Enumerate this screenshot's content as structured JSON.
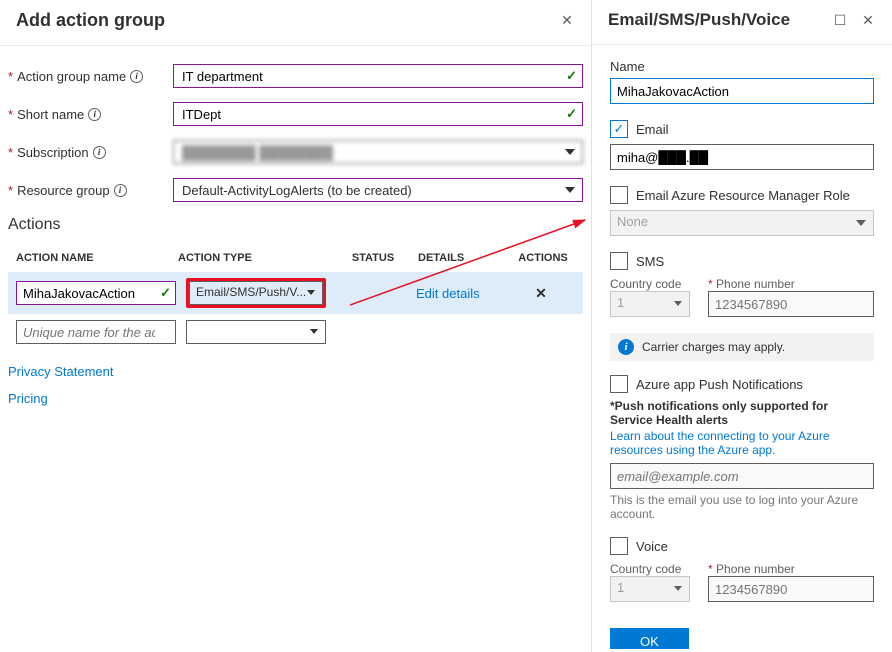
{
  "left_panel": {
    "title": "Add action group",
    "fields": {
      "action_group_name": {
        "label": "Action group name",
        "value": "IT department"
      },
      "short_name": {
        "label": "Short name",
        "value": "ITDept"
      },
      "subscription": {
        "label": "Subscription",
        "value": "████████  ████████"
      },
      "resource_group": {
        "label": "Resource group",
        "value": "Default-ActivityLogAlerts (to be created)"
      }
    },
    "actions_section": "Actions",
    "columns": {
      "name": "ACTION NAME",
      "type": "ACTION TYPE",
      "status": "STATUS",
      "details": "DETAILS",
      "actions": "ACTIONS"
    },
    "rows": [
      {
        "name": "MihaJakovacAction",
        "type": "Email/SMS/Push/V...",
        "details": "Edit details"
      }
    ],
    "placeholder_row": "Unique name for the act...",
    "links": {
      "privacy": "Privacy Statement",
      "pricing": "Pricing"
    }
  },
  "right_panel": {
    "title": "Email/SMS/Push/Voice",
    "name_label": "Name",
    "name_value": "MihaJakovacAction",
    "email_cb": "Email",
    "email_value": "miha@███.██",
    "arm_cb": "Email Azure Resource Manager Role",
    "arm_value": "None",
    "sms_cb": "SMS",
    "country_label": "Country code",
    "phone_label": "Phone number",
    "country_value": "1",
    "phone_ph": "1234567890",
    "info_bar": "Carrier charges may apply.",
    "push_cb": "Azure app Push Notifications",
    "push_note": "*Push notifications only supported for Service Health alerts",
    "push_learn": "Learn about the connecting to your Azure resources using the Azure app.",
    "push_ph": "email@example.com",
    "push_helper": "This is the email you use to log into your Azure account.",
    "voice_cb": "Voice",
    "ok": "OK"
  }
}
